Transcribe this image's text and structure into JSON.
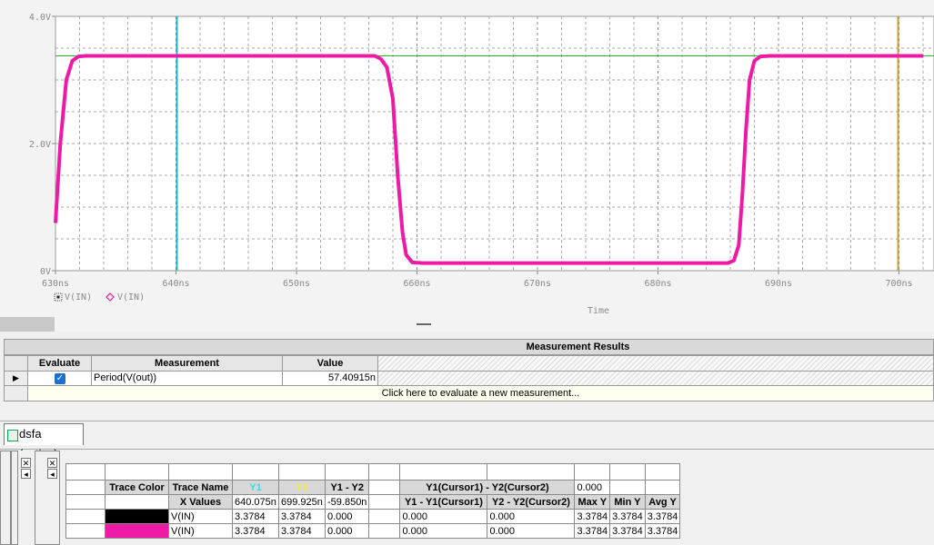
{
  "plot": {
    "y_ticks": [
      "4.0V",
      "2.0V",
      "0V"
    ],
    "x_ticks": [
      "630ns",
      "640ns",
      "650ns",
      "660ns",
      "670ns",
      "680ns",
      "690ns",
      "700ns"
    ],
    "legend": [
      "V(IN)",
      "V(IN)"
    ],
    "xlabel": "Time",
    "trace_color": "#ee1aa6",
    "cursor1_color": "#21b5c8",
    "cursor2_color": "#c9a22a",
    "hline_color": "#25b925"
  },
  "chart_data": {
    "type": "line",
    "title": "",
    "xlabel": "Time",
    "ylabel": "",
    "xlim": [
      630,
      702
    ],
    "ylim": [
      0,
      4.0
    ],
    "x_unit": "ns",
    "y_unit": "V",
    "series": [
      {
        "name": "V(IN)",
        "x": [
          630,
          630.4,
          630.9,
          631.4,
          631.9,
          632.5,
          633.5,
          656.5,
          657.0,
          657.5,
          658.0,
          658.4,
          658.8,
          659.1,
          659.6,
          660.5,
          685.8,
          686.3,
          686.7,
          687.0,
          687.3,
          687.6,
          688.0,
          688.5,
          689.3,
          702
        ],
        "y": [
          0.75,
          2.0,
          3.0,
          3.3,
          3.37,
          3.3784,
          3.3784,
          3.3784,
          3.33,
          3.2,
          2.7,
          1.5,
          0.6,
          0.25,
          0.13,
          0.12,
          0.12,
          0.16,
          0.4,
          1.2,
          2.2,
          3.0,
          3.3,
          3.37,
          3.3784,
          3.3784
        ]
      }
    ],
    "cursors": [
      640.075,
      699.925
    ],
    "hline": 3.3784,
    "grid": true
  },
  "measurement": {
    "title": "Measurement Results",
    "col_evaluate": "Evaluate",
    "col_measurement": "Measurement",
    "col_value": "Value",
    "row_measurement": "Period(V(out))",
    "row_value": "57.40915n",
    "add_hint": "Click here to evaluate a new measurement..."
  },
  "tab": {
    "label": "dsfa (active)"
  },
  "cursor_table": {
    "h_trace_color": "Trace Color",
    "h_trace_name": "Trace Name",
    "h_y1": "Y1",
    "h_y2": "Y2",
    "h_y1_y2": "Y1 - Y2",
    "h_cursor_diff": "Y1(Cursor1) - Y2(Cursor2)",
    "h_cursor_diff_value": "0.000",
    "r1_label": "X Values",
    "r1_y1": "640.075n",
    "r1_y2": "699.925n",
    "r1_diff": "-59.850n",
    "h_y1_c1": "Y1 - Y1(Cursor1)",
    "h_y2_c2": "Y2 - Y2(Cursor2)",
    "h_max": "Max Y",
    "h_min": "Min Y",
    "h_avg": "Avg Y",
    "rows": [
      {
        "color": "#000000",
        "name": "V(IN)",
        "y1": "3.3784",
        "y2": "3.3784",
        "diff": "0.000",
        "d1": "0.000",
        "d2": "0.000",
        "max": "3.3784",
        "min": "3.3784",
        "avg": "3.3784"
      },
      {
        "color": "#ee1aa6",
        "name": "V(IN)",
        "y1": "3.3784",
        "y2": "3.3784",
        "diff": "0.000",
        "d1": "0.000",
        "d2": "0.000",
        "max": "3.3784",
        "min": "3.3784",
        "avg": "3.3784"
      }
    ]
  }
}
